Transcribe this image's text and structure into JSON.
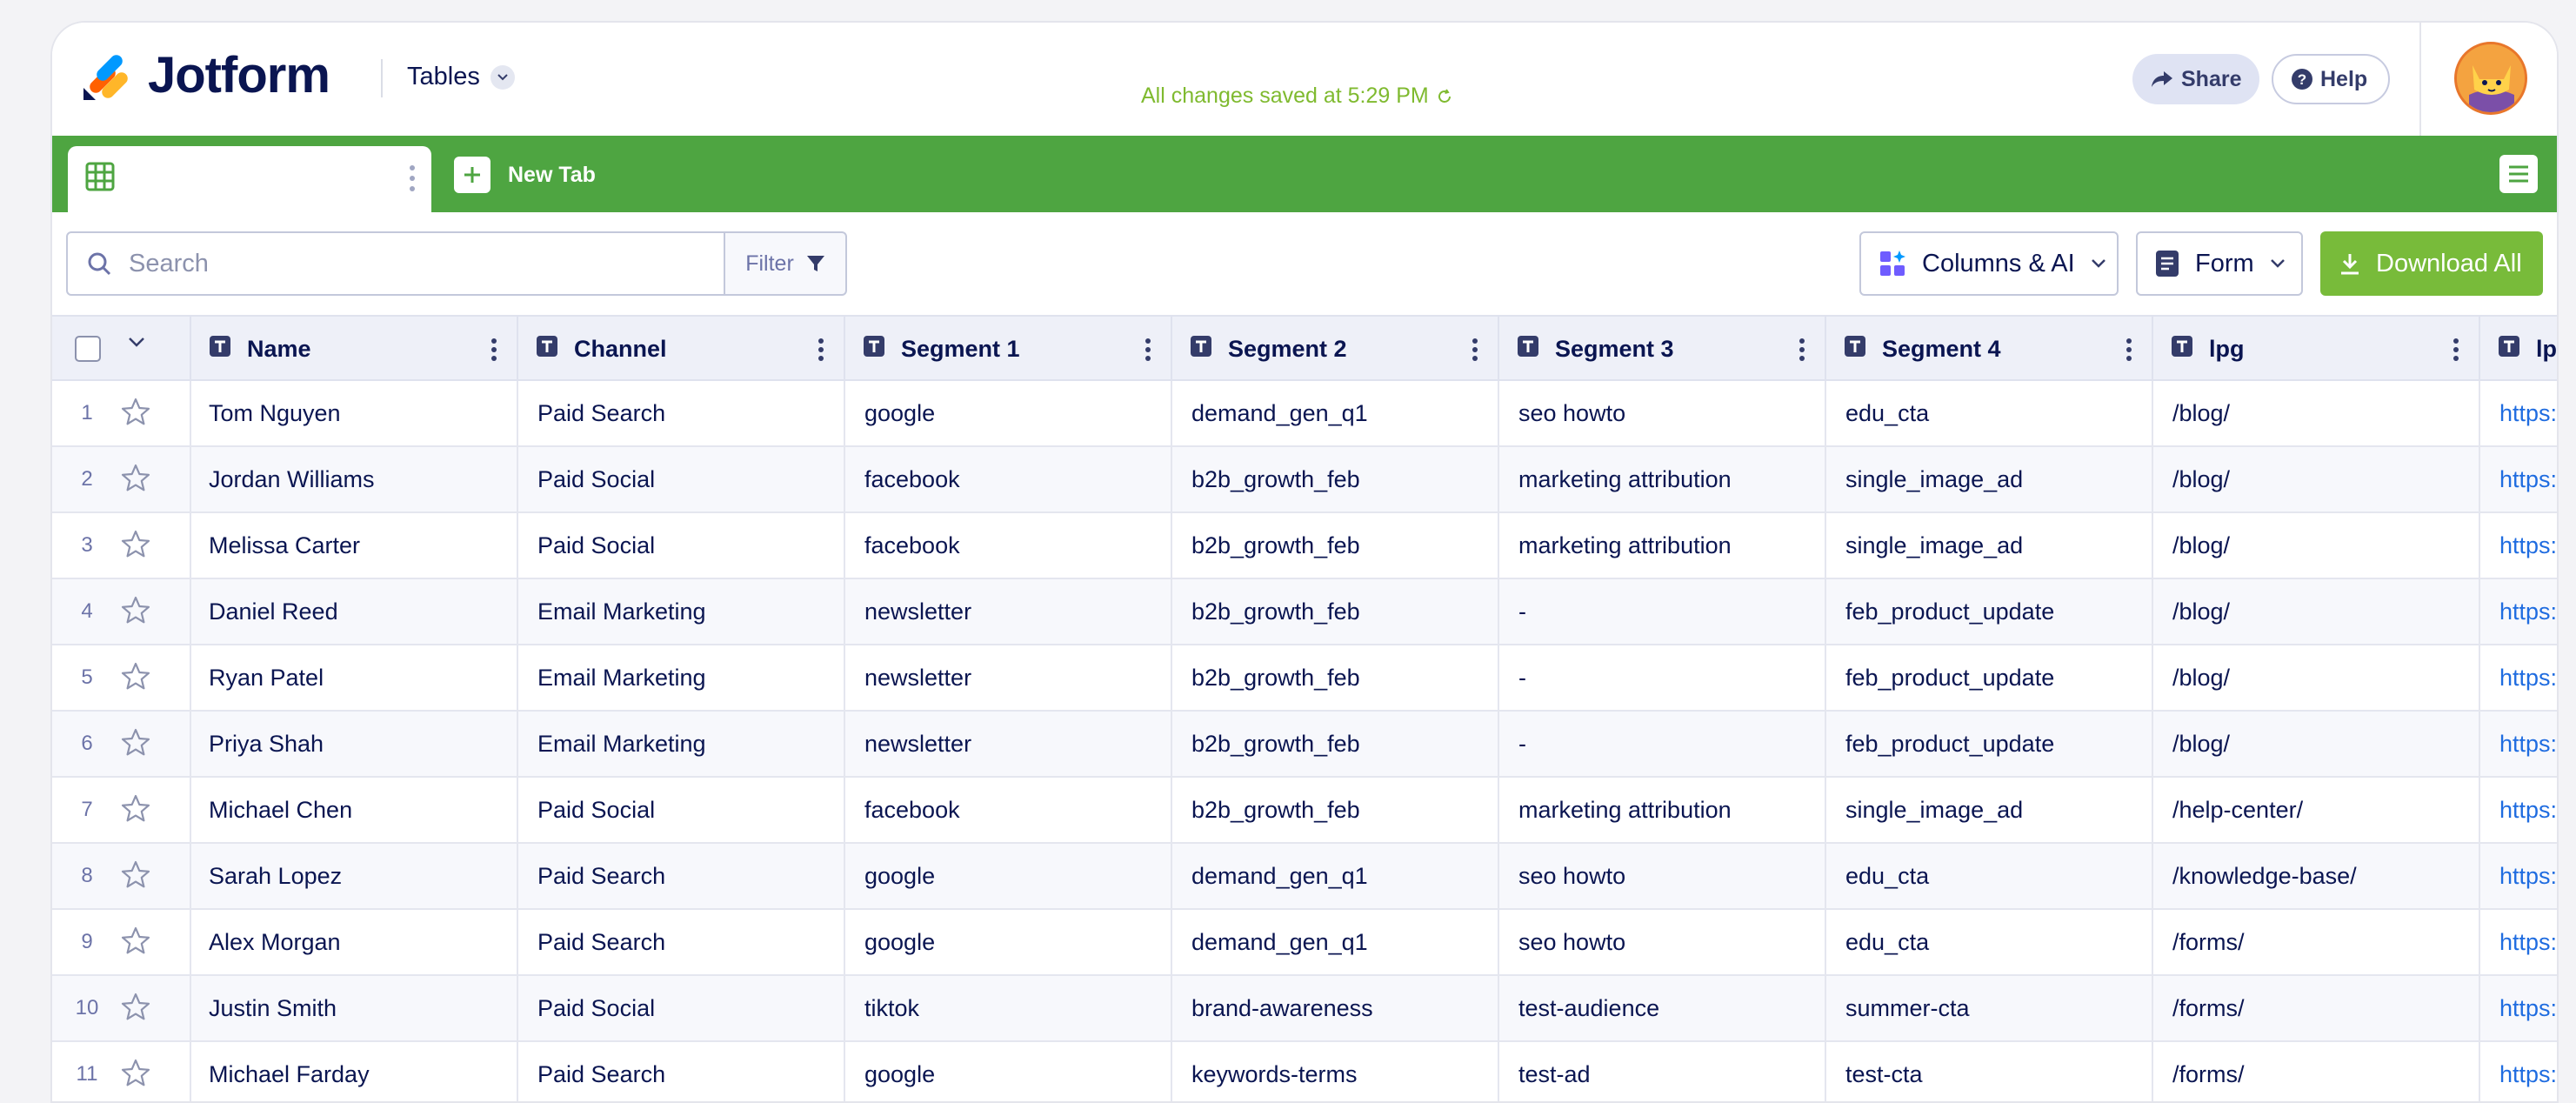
{
  "header": {
    "brand": "Jotform",
    "product_menu": "Tables",
    "saved_status": "All changes saved at 5:29 PM",
    "share_label": "Share",
    "help_label": "Help"
  },
  "tabbar": {
    "new_tab_label": "New Tab"
  },
  "toolbar": {
    "search_placeholder": "Search",
    "filter_label": "Filter",
    "columns_label": "Columns & AI",
    "form_label": "Form",
    "download_label": "Download All"
  },
  "table": {
    "columns": [
      "Name",
      "Channel",
      "Segment 1",
      "Segment 2",
      "Segment 3",
      "Segment 4",
      "lpg",
      "lp"
    ],
    "rows": [
      {
        "num": "1",
        "cells": [
          "Tom Nguyen",
          "Paid Search",
          "google",
          "demand_gen_q1",
          "seo howto",
          "edu_cta",
          "/blog/",
          "https:/"
        ]
      },
      {
        "num": "2",
        "cells": [
          "Jordan Williams",
          "Paid Social",
          "facebook",
          "b2b_growth_feb",
          "marketing attribution",
          "single_image_ad",
          "/blog/",
          "https:/"
        ]
      },
      {
        "num": "3",
        "cells": [
          "Melissa Carter",
          "Paid Social",
          "facebook",
          "b2b_growth_feb",
          "marketing attribution",
          "single_image_ad",
          "/blog/",
          "https:/"
        ]
      },
      {
        "num": "4",
        "cells": [
          "Daniel Reed",
          "Email Marketing",
          "newsletter",
          "b2b_growth_feb",
          "-",
          "feb_product_update",
          "/blog/",
          "https:/"
        ]
      },
      {
        "num": "5",
        "cells": [
          "Ryan Patel",
          "Email Marketing",
          "newsletter",
          "b2b_growth_feb",
          "-",
          "feb_product_update",
          "/blog/",
          "https:/"
        ]
      },
      {
        "num": "6",
        "cells": [
          "Priya Shah",
          "Email Marketing",
          "newsletter",
          "b2b_growth_feb",
          "-",
          "feb_product_update",
          "/blog/",
          "https:/"
        ]
      },
      {
        "num": "7",
        "cells": [
          "Michael Chen",
          "Paid Social",
          "facebook",
          "b2b_growth_feb",
          "marketing attribution",
          "single_image_ad",
          "/help-center/",
          "https:/"
        ]
      },
      {
        "num": "8",
        "cells": [
          "Sarah Lopez",
          "Paid Search",
          "google",
          "demand_gen_q1",
          "seo howto",
          "edu_cta",
          "/knowledge-base/",
          "https:/"
        ]
      },
      {
        "num": "9",
        "cells": [
          "Alex Morgan",
          "Paid Search",
          "google",
          "demand_gen_q1",
          "seo howto",
          "edu_cta",
          "/forms/",
          "https:/"
        ]
      },
      {
        "num": "10",
        "cells": [
          "Justin Smith",
          "Paid Social",
          "tiktok",
          "brand-awareness",
          "test-audience",
          "summer-cta",
          "/forms/",
          "https:/"
        ]
      },
      {
        "num": "11",
        "cells": [
          "Michael Farday",
          "Paid Search",
          "google",
          "keywords-terms",
          "test-ad",
          "test-cta",
          "/forms/",
          "https:/"
        ]
      }
    ]
  },
  "colors": {
    "green_bar": "#4ea541",
    "download_green": "#78bb3a",
    "saved_green": "#7fba2f",
    "navy": "#0a1551",
    "link_blue": "#1f6ce0"
  }
}
